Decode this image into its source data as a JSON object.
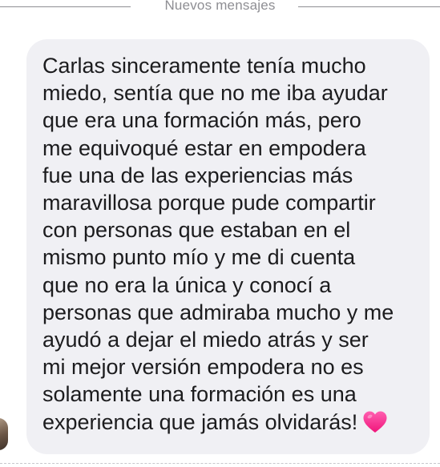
{
  "divider": {
    "label": "Nuevos mensajes"
  },
  "message": {
    "lines": [
      "Carlas sinceramente tenía mucho",
      "miedo, sentía que no me iba ayudar",
      "que era una formación más, pero",
      "me equivoqué estar en empodera",
      "fue una de las experiencias más",
      "maravillosa porque pude compartir",
      "con personas que estaban en el",
      "mismo punto mío y me di cuenta",
      "que no era la única y conocí a",
      "personas que admiraba mucho y me",
      "ayudó a dejar el miedo atrás y ser",
      "mi mejor versión empodera no es",
      "solamente una formación es una",
      "experiencia que jamás olvidarás!"
    ],
    "emoji": "pink-heart-icon"
  },
  "colors": {
    "bubble_background": "#f0f0f4",
    "text": "#1c1c1e",
    "divider": "#8e8e93",
    "heart": "#ff2d8f"
  }
}
